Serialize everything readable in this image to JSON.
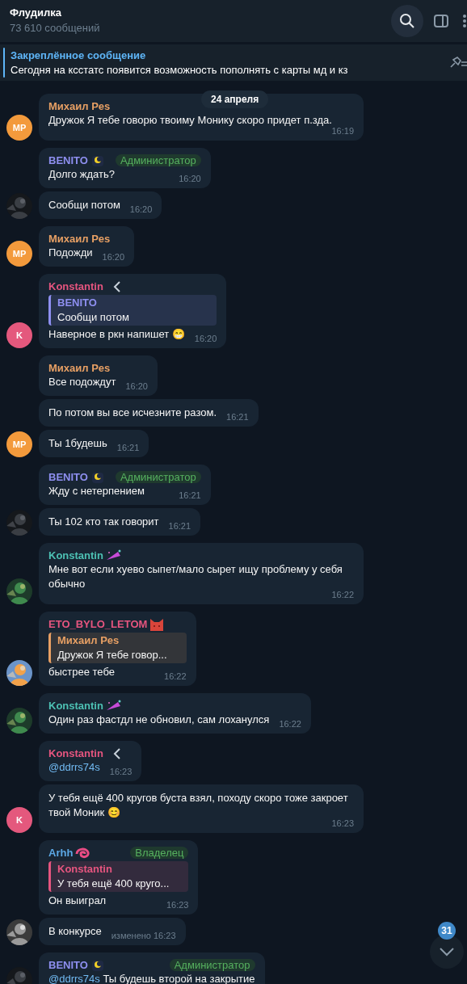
{
  "header": {
    "title": "Флудилка",
    "subtitle": "73 610 сообщений"
  },
  "pinned": {
    "title": "Закреплённое сообщение",
    "text": "Сегодня на ксстатс появится возможность пополнять с карты мд и кз"
  },
  "date": "24 апреля",
  "groups": [
    {
      "avatar": {
        "kind": "initials",
        "text": "MP",
        "color": "#f39a3c"
      },
      "messages": [
        {
          "sender": "Михаил Pes",
          "color": "#e8a064",
          "text": "Дружок Я тебе говорю твоиму Монику скоро придет п.зда.",
          "time": "16:19"
        }
      ]
    },
    {
      "avatar": {
        "kind": "picture"
      },
      "messages": [
        {
          "sender": "BENITO",
          "color": "#8e8ff0",
          "name_icon": {
            "kind": "emoji"
          },
          "badge": "Администратор",
          "text": "Долго ждать?",
          "time": "16:20"
        },
        {
          "text": "Сообщи потом",
          "time": "16:20"
        }
      ]
    },
    {
      "avatar": {
        "kind": "initials",
        "text": "MP",
        "color": "#f39a3c"
      },
      "messages": [
        {
          "sender": "Михаил Pes",
          "color": "#e8a064",
          "text": "Подожди",
          "time": "16:20"
        }
      ]
    },
    {
      "avatar": {
        "kind": "initials",
        "text": "K",
        "color": "#e4587d"
      },
      "messages": [
        {
          "sender": "Konstantin",
          "color": "#e6557f",
          "name_icon": {
            "kind": "chevron"
          },
          "quote": {
            "name": "BENITO",
            "text": "Сообщи потом",
            "color": "#8e8ff0"
          },
          "text": "Наверное в ркн напишет 😁",
          "time": "16:20"
        }
      ]
    },
    {
      "avatar": {
        "kind": "initials",
        "text": "MP",
        "color": "#f39a3c"
      },
      "messages": [
        {
          "sender": "Михаил Pes",
          "color": "#e8a064",
          "text": "Все подождут",
          "time": "16:20"
        },
        {
          "text": "По потом вы все исчезните разом.",
          "time": "16:21"
        },
        {
          "text": "Ты 1будешь",
          "time": "16:21"
        }
      ]
    },
    {
      "avatar": {
        "kind": "picture"
      },
      "messages": [
        {
          "sender": "BENITO",
          "color": "#8e8ff0",
          "name_icon": {
            "kind": "emoji"
          },
          "badge": "Администратор",
          "text": "Жду с нетерпением",
          "time": "16:21"
        },
        {
          "text": "Ты 102 кто так говорит",
          "time": "16:21"
        }
      ]
    },
    {
      "avatar": {
        "kind": "picture"
      },
      "messages": [
        {
          "sender": "Konstantin",
          "color": "#4dc1b4",
          "name_icon": {
            "kind": "emoji"
          },
          "text": "Мне вот если хуево сыпет/мало сырет ищу проблему у себя обычно",
          "time": "16:22"
        }
      ]
    },
    {
      "avatar": {
        "kind": "picture"
      },
      "messages": [
        {
          "sender": "ETO_BYLO_LETOM",
          "color": "#e6557f",
          "name_icon": {
            "kind": "emoji"
          },
          "quote": {
            "name": "Михаил Pes",
            "text": "Дружок Я тебе говор...",
            "color": "#e8a064"
          },
          "text": "быстрее тебе",
          "time": "16:22"
        }
      ]
    },
    {
      "avatar": {
        "kind": "picture"
      },
      "messages": [
        {
          "sender": "Konstantin",
          "color": "#4dc1b4",
          "name_icon": {
            "kind": "emoji"
          },
          "text": "Один раз фастдл не обновил, сам лоханулся",
          "time": "16:22"
        }
      ]
    },
    {
      "avatar": {
        "kind": "initials",
        "text": "K",
        "color": "#e4587d"
      },
      "messages": [
        {
          "sender": "Konstantin",
          "color": "#e6557f",
          "name_icon": {
            "kind": "chevron"
          },
          "mention": "@ddrrs74s",
          "time": "16:23"
        },
        {
          "text": "У тебя ещё 400 кругов буста взял, походу скоро тоже закроет твой Моник 😊",
          "time": "16:23"
        }
      ]
    },
    {
      "avatar": {
        "kind": "picture"
      },
      "messages": [
        {
          "sender": "Arhh",
          "color": "#5ca9e6",
          "name_icon": {
            "kind": "emoji"
          },
          "badge": "Владелец",
          "quote": {
            "name": "Konstantin",
            "text": "У тебя ещё 400 круго...",
            "color": "#e6557f"
          },
          "text": "Он выиграл",
          "time": "16:23"
        },
        {
          "text": "В конкурсе",
          "edited": "изменено",
          "time": "16:23"
        }
      ]
    },
    {
      "avatar": {
        "kind": "picture"
      },
      "messages": [
        {
          "sender": "BENITO",
          "color": "#8e8ff0",
          "name_icon": {
            "kind": "emoji"
          },
          "badge": "Администратор",
          "mention": "@ddrrs74s",
          "text": "Ты будешь второй на закрытие"
        }
      ]
    }
  ],
  "unread_count": "31"
}
